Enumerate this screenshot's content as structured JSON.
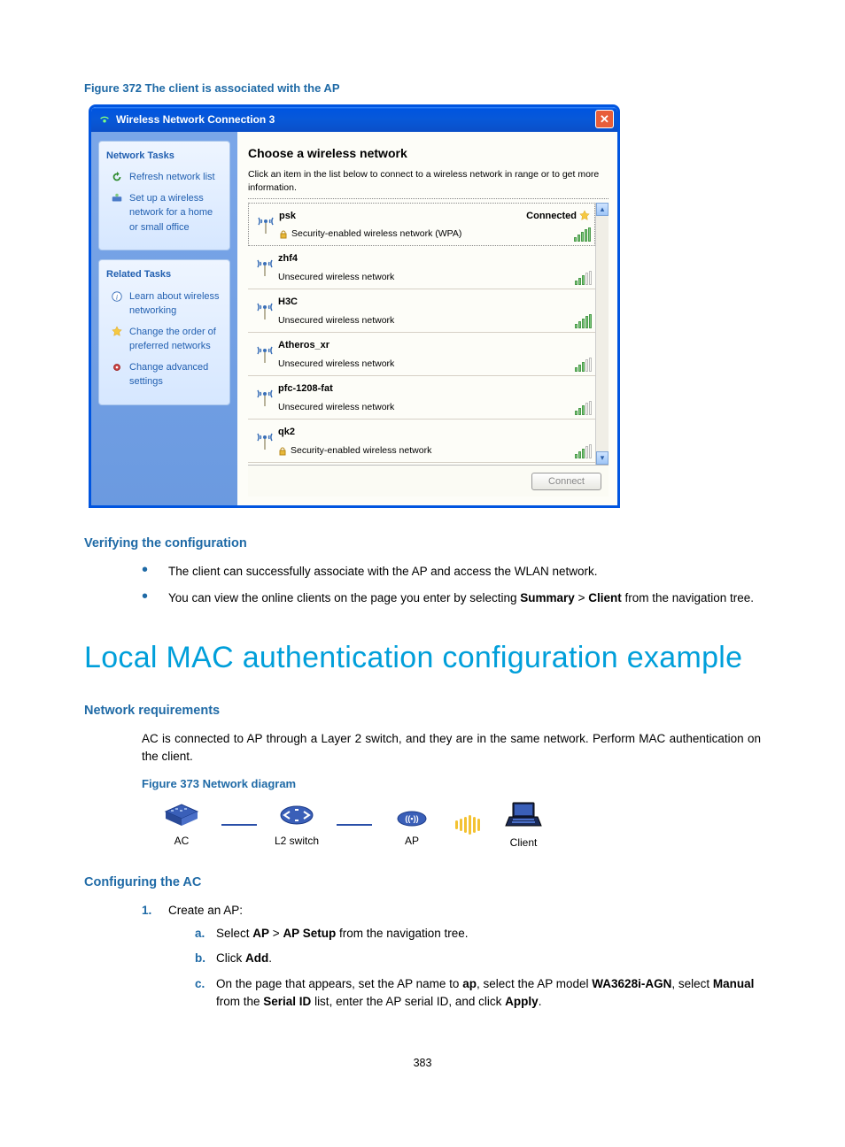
{
  "fig372_caption": "Figure 372 The client is associated with the AP",
  "xp": {
    "title": "Wireless Network Connection 3",
    "sidebar": {
      "panel1_title": "Network Tasks",
      "task_refresh": "Refresh network list",
      "task_setup": "Set up a wireless network for a home or small office",
      "panel2_title": "Related Tasks",
      "task_learn": "Learn about wireless networking",
      "task_order": "Change the order of preferred networks",
      "task_adv": "Change advanced settings"
    },
    "main": {
      "heading": "Choose a wireless network",
      "subheading": "Click an item in the list below to connect to a wireless network in range or to get more information.",
      "connected_label": "Connected",
      "sec_wpa": "Security-enabled wireless network (WPA)",
      "sec_open": "Unsecured wireless network",
      "sec_enabled": "Security-enabled wireless network",
      "connect_btn": "Connect"
    },
    "networks": [
      {
        "ssid": "psk",
        "security": "sec_wpa",
        "connected": true,
        "strong": true,
        "lock": true
      },
      {
        "ssid": "zhf4",
        "security": "sec_open",
        "connected": false,
        "strong": false,
        "lock": false
      },
      {
        "ssid": "H3C",
        "security": "sec_open",
        "connected": false,
        "strong": true,
        "lock": false
      },
      {
        "ssid": "Atheros_xr",
        "security": "sec_open",
        "connected": false,
        "strong": false,
        "lock": false
      },
      {
        "ssid": "pfc-1208-fat",
        "security": "sec_open",
        "connected": false,
        "strong": false,
        "lock": false
      },
      {
        "ssid": "qk2",
        "security": "sec_enabled",
        "connected": false,
        "strong": false,
        "lock": true
      }
    ]
  },
  "h_verify": "Verifying the configuration",
  "bullets_verify": [
    "The client can successfully associate with the AP and access the WLAN network.",
    "You can view the online clients on the page you enter by selecting Summary > Client from the navigation tree."
  ],
  "h1": "Local MAC authentication configuration example",
  "h_netreq": "Network requirements",
  "p_netreq": "AC is connected to AP through a Layer 2 switch, and they are in the same network. Perform MAC authentication on the client.",
  "fig373_caption": "Figure 373 Network diagram",
  "diagram_labels": {
    "ac": "AC",
    "l2": "L2 switch",
    "ap": "AP",
    "client": "Client"
  },
  "h_confac": "Configuring the AC",
  "step1": "Create an AP:",
  "sub_a_pre": "Select ",
  "sub_a_b1": "AP",
  "sub_a_mid": " > ",
  "sub_a_b2": "AP Setup",
  "sub_a_post": " from the navigation tree.",
  "sub_b_pre": "Click ",
  "sub_b_b": "Add",
  "sub_b_post": ".",
  "sub_c_1": "On the page that appears, set the AP name to ",
  "sub_c_b1": "ap",
  "sub_c_2": ", select the AP model ",
  "sub_c_b2": "WA3628i-AGN",
  "sub_c_3": ", select ",
  "sub_c_b3": "Manual",
  "sub_c_4": " from the ",
  "sub_c_b4": "Serial ID",
  "sub_c_5": " list, enter the AP serial ID, and click ",
  "sub_c_b5": "Apply",
  "sub_c_6": ".",
  "page_num": "383"
}
